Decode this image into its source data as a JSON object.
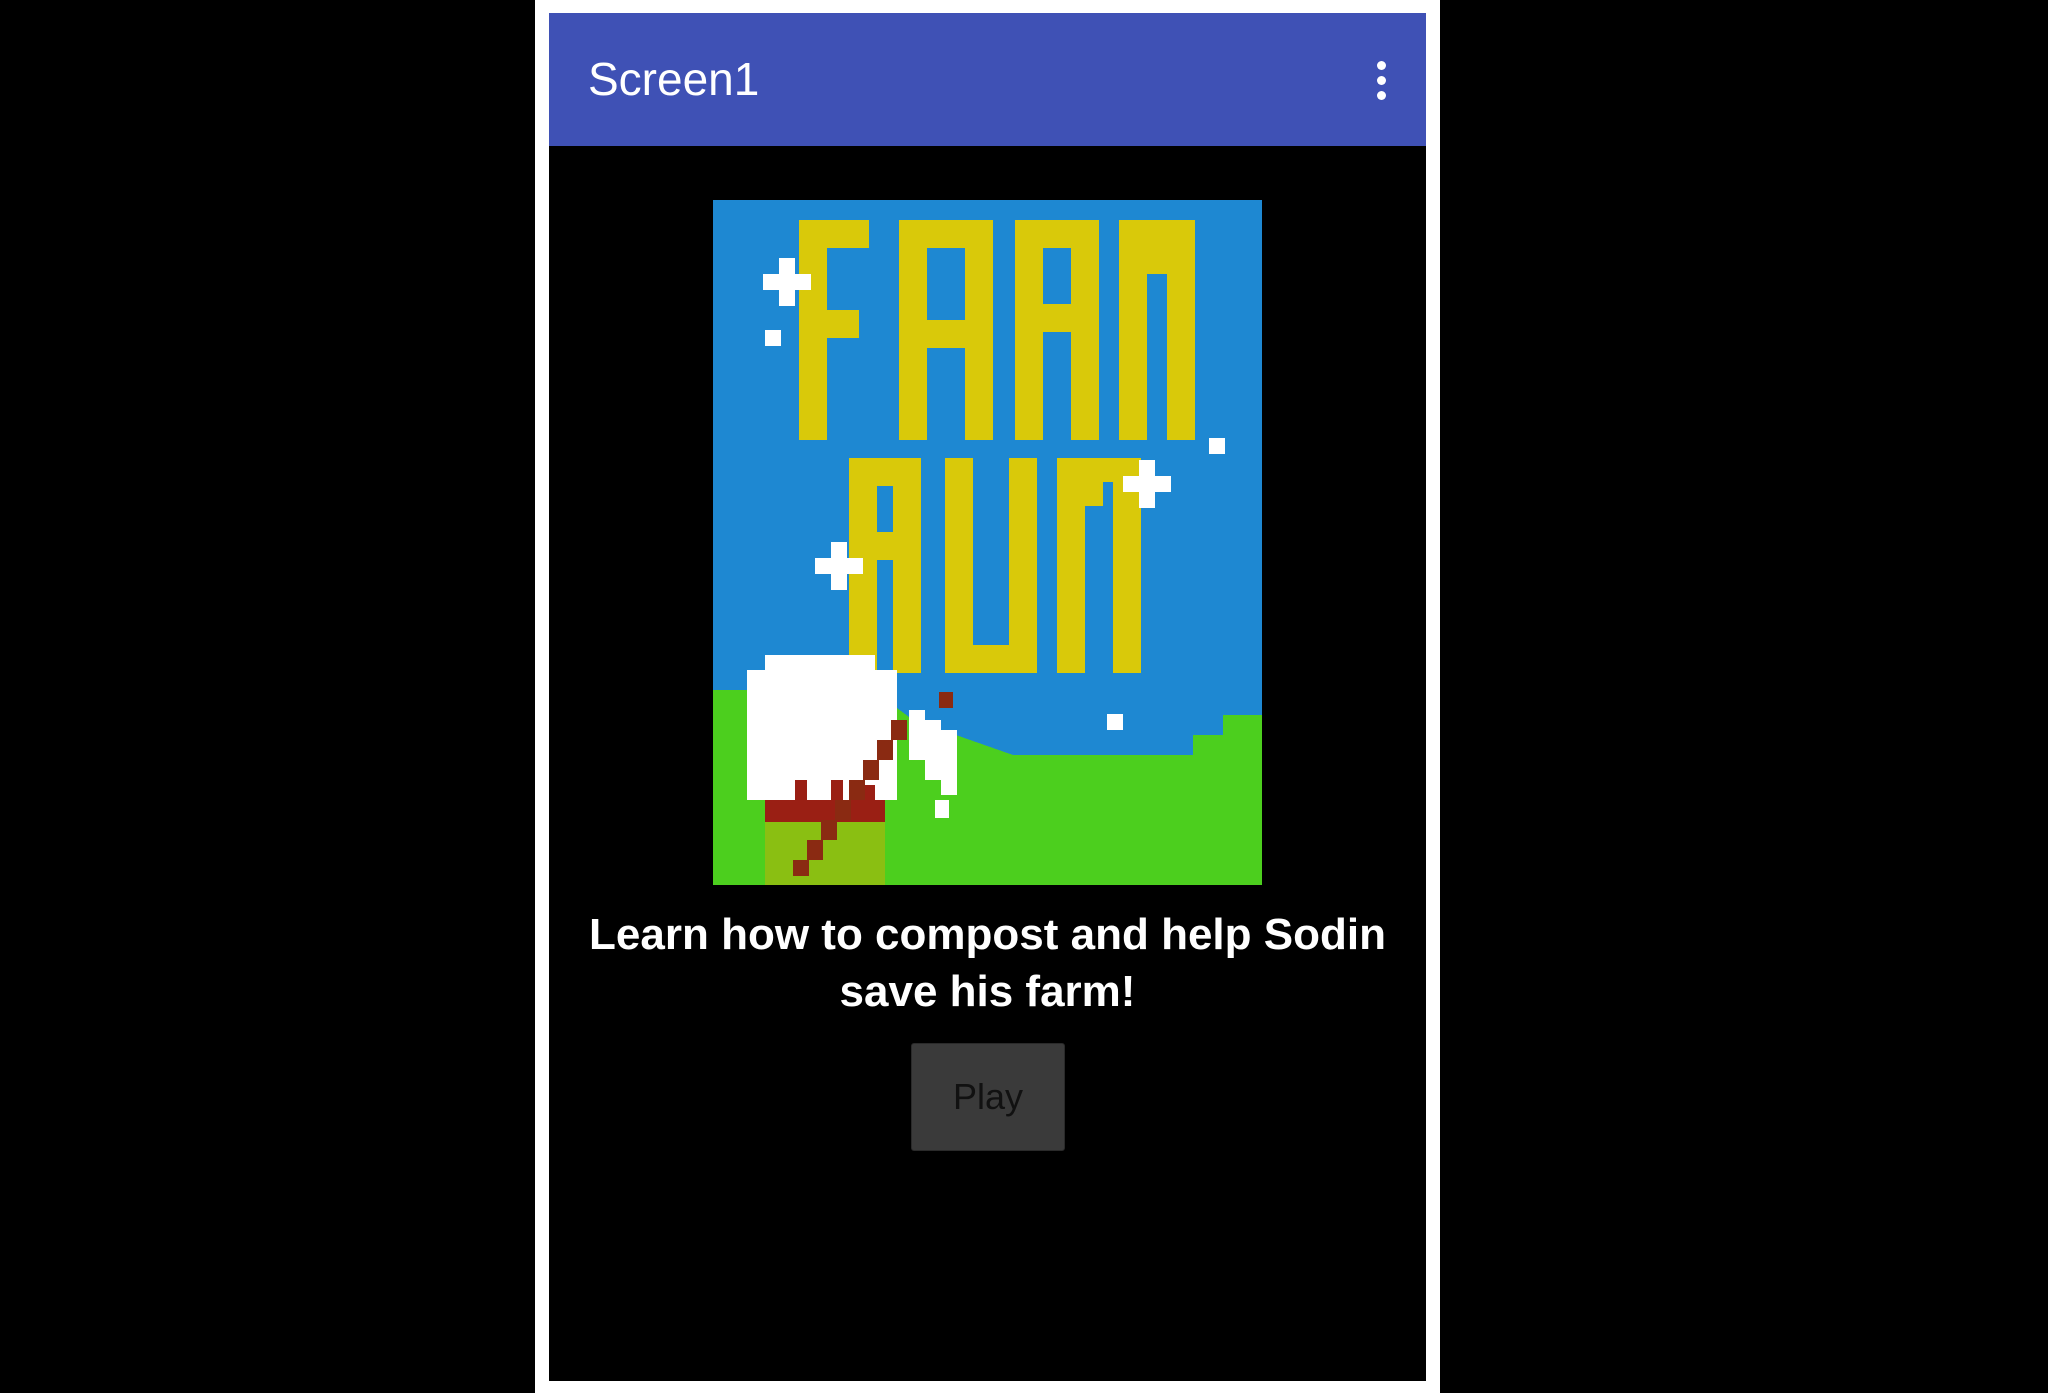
{
  "app_bar": {
    "title": "Screen1",
    "overflow_icon": "more-vert-icon",
    "color": "#3f51b5"
  },
  "hero": {
    "logo_text": [
      "FARM",
      "RUN"
    ],
    "sky_color": "#1e88d2",
    "letter_color": "#d9c90a",
    "grass_color": "#4ccf1e"
  },
  "tagline": "Learn how to compost and help Sodin save his farm!",
  "play_button": {
    "label": "Play"
  }
}
